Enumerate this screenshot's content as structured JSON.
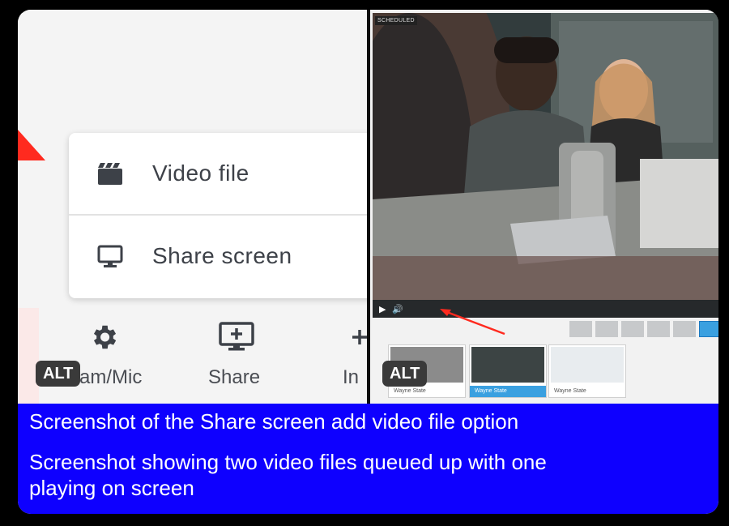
{
  "left_panel": {
    "menu": {
      "items": [
        {
          "label": "Video file",
          "icon": "film-icon"
        },
        {
          "label": "Share screen",
          "icon": "monitor-icon"
        }
      ]
    },
    "toolbar": {
      "items": [
        {
          "label": "am/Mic",
          "icon": "gear-icon"
        },
        {
          "label": "Share",
          "icon": "share-screen-icon"
        },
        {
          "label": "In",
          "icon": "add-icon"
        }
      ]
    },
    "alt_badge": "ALT"
  },
  "right_panel": {
    "video": {
      "badge": "SCHEDULED"
    },
    "thumbnails": [
      {
        "caption": "Wayne State",
        "selected": false
      },
      {
        "caption": "Wayne State",
        "selected": true
      },
      {
        "caption": "Wayne State",
        "selected": false
      }
    ],
    "alt_badge": "ALT"
  },
  "caption": {
    "lines": [
      "Screenshot of the Share screen add video file option",
      "Screenshot showing two video files queued up with one",
      "playing on screen"
    ]
  },
  "colors": {
    "caption_bg": "#0e00ff",
    "accent_red": "#ff2a1f",
    "selected_thumb": "#3aa0e0"
  }
}
